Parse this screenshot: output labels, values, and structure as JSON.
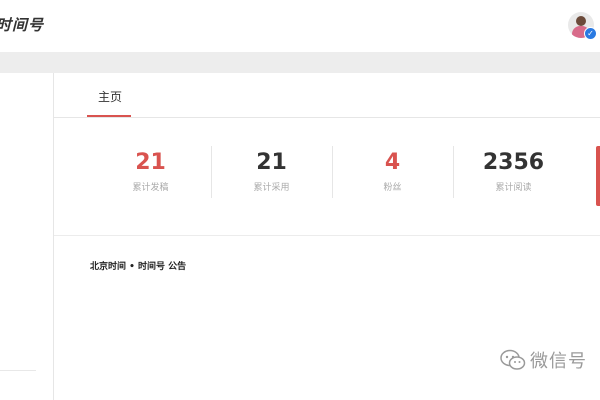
{
  "header": {
    "brand": "时间号"
  },
  "tabs": [
    {
      "label": "主页"
    }
  ],
  "stats": [
    {
      "value": "21",
      "label": "累计发稿",
      "color": "#d9534f"
    },
    {
      "value": "21",
      "label": "累计采用",
      "color": "#333333"
    },
    {
      "value": "4",
      "label": "粉丝",
      "color": "#d9534f"
    },
    {
      "value": "2356",
      "label": "累计阅读",
      "color": "#333333"
    }
  ],
  "notice": {
    "title": "北京时间 • 时间号 公告"
  },
  "watermark": {
    "text": "微信号",
    "icon": "wechat-icon"
  },
  "colors": {
    "accent": "#d9534f",
    "verified": "#2a7ae2"
  }
}
